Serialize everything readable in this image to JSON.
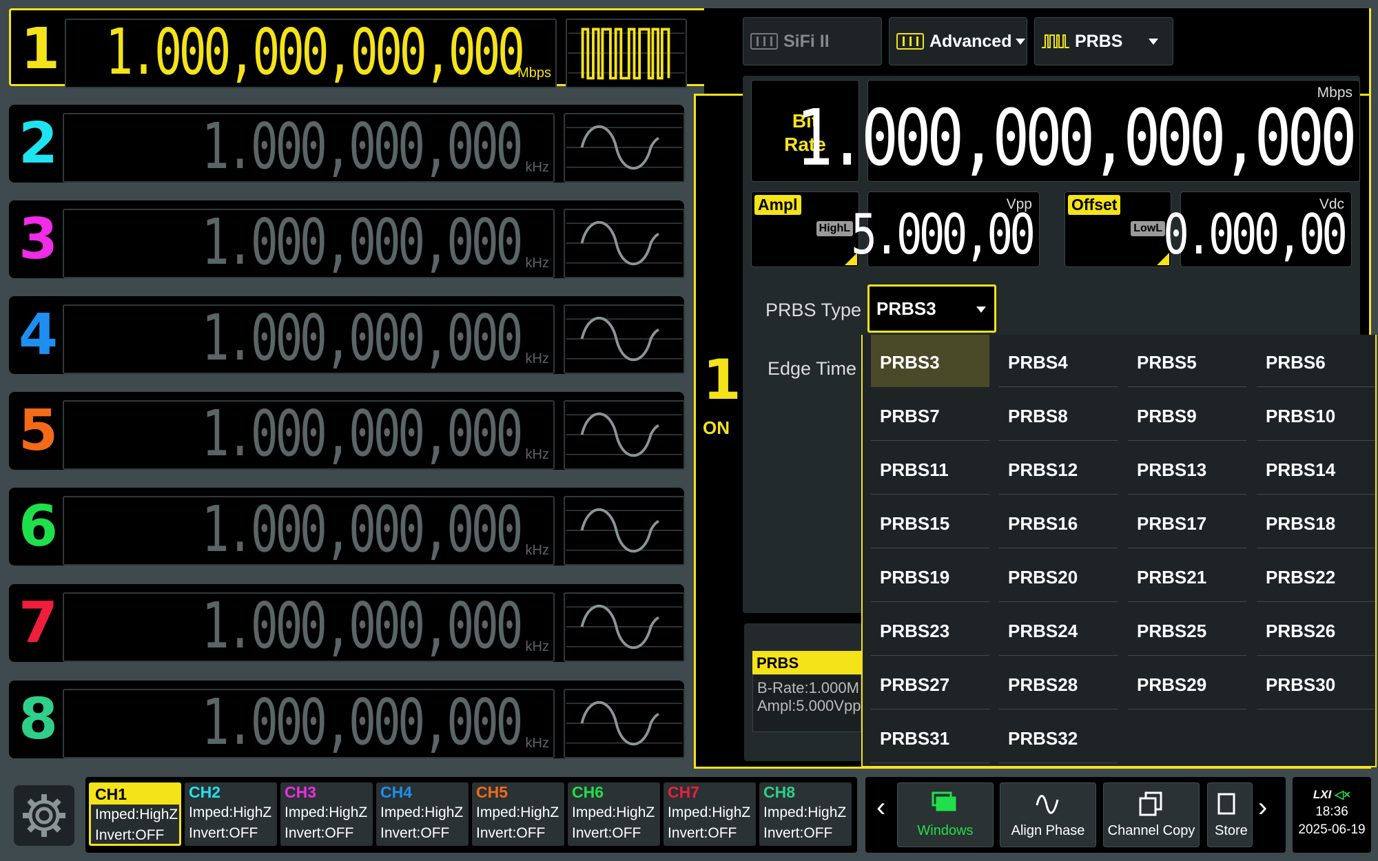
{
  "channels": [
    {
      "num": "1",
      "freq": "1.000,000,000,000",
      "unit": "Mbps",
      "color": "#f5e31a",
      "wave": "prbs"
    },
    {
      "num": "2",
      "freq": "1.000,000,000",
      "unit": "kHz",
      "color": "#1ee4f0",
      "wave": "sine"
    },
    {
      "num": "3",
      "freq": "1.000,000,000",
      "unit": "kHz",
      "color": "#ef2ce6",
      "wave": "sine"
    },
    {
      "num": "4",
      "freq": "1.000,000,000",
      "unit": "kHz",
      "color": "#1e8ff0",
      "wave": "sine"
    },
    {
      "num": "5",
      "freq": "1.000,000,000",
      "unit": "kHz",
      "color": "#f56a16",
      "wave": "sine"
    },
    {
      "num": "6",
      "freq": "1.000,000,000",
      "unit": "kHz",
      "color": "#1fe04a",
      "wave": "sine"
    },
    {
      "num": "7",
      "freq": "1.000,000,000",
      "unit": "kHz",
      "color": "#f01e3a",
      "wave": "sine"
    },
    {
      "num": "8",
      "freq": "1.000,000,000",
      "unit": "kHz",
      "color": "#2fcf8a",
      "wave": "sine"
    }
  ],
  "inactive_freq_color": "#5a6566",
  "mode_buttons": {
    "sifi": "SiFi II",
    "advanced": "Advanced",
    "prbs": "PRBS"
  },
  "active_channel": {
    "num": "1",
    "state": "ON"
  },
  "bit_rate": {
    "label": "Bit Rate",
    "value": "1.000,000,000,000",
    "unit": "Mbps"
  },
  "ampl": {
    "label": "Ampl",
    "sub": "HighL",
    "value": "5.000,00",
    "unit": "Vpp"
  },
  "offset": {
    "label": "Offset",
    "sub": "LowL",
    "value": "0.000,00",
    "unit": "Vdc"
  },
  "prbs_type": {
    "label": "PRBS Type",
    "value": "PRBS3"
  },
  "edge_time_label": "Edge Time",
  "prbs_options": [
    "PRBS3",
    "PRBS4",
    "PRBS5",
    "PRBS6",
    "PRBS7",
    "PRBS8",
    "PRBS9",
    "PRBS10",
    "PRBS11",
    "PRBS12",
    "PRBS13",
    "PRBS14",
    "PRBS15",
    "PRBS16",
    "PRBS17",
    "PRBS18",
    "PRBS19",
    "PRBS20",
    "PRBS21",
    "PRBS22",
    "PRBS23",
    "PRBS24",
    "PRBS25",
    "PRBS26",
    "PRBS27",
    "PRBS28",
    "PRBS29",
    "PRBS30",
    "PRBS31",
    "PRBS32"
  ],
  "info_card": {
    "title": "PRBS",
    "line1": "B-Rate:1.000M",
    "line2": "Ampl:5.000Vpp"
  },
  "ch_tabs": [
    {
      "name": "CH1",
      "imped": "Imped:HighZ",
      "invert": "Invert:OFF",
      "color": "#f5e31a"
    },
    {
      "name": "CH2",
      "imped": "Imped:HighZ",
      "invert": "Invert:OFF",
      "color": "#1ee4f0"
    },
    {
      "name": "CH3",
      "imped": "Imped:HighZ",
      "invert": "Invert:OFF",
      "color": "#ef2ce6"
    },
    {
      "name": "CH4",
      "imped": "Imped:HighZ",
      "invert": "Invert:OFF",
      "color": "#1e8ff0"
    },
    {
      "name": "CH5",
      "imped": "Imped:HighZ",
      "invert": "Invert:OFF",
      "color": "#f56a16"
    },
    {
      "name": "CH6",
      "imped": "Imped:HighZ",
      "invert": "Invert:OFF",
      "color": "#1fe04a"
    },
    {
      "name": "CH7",
      "imped": "Imped:HighZ",
      "invert": "Invert:OFF",
      "color": "#f01e3a"
    },
    {
      "name": "CH8",
      "imped": "Imped:HighZ",
      "invert": "Invert:OFF",
      "color": "#2fcf8a"
    }
  ],
  "func_buttons": [
    "Windows",
    "Align Phase",
    "Channel Copy",
    "Store"
  ],
  "status": {
    "lxi": "LXI",
    "time": "18:36",
    "date": "2025-06-19"
  }
}
